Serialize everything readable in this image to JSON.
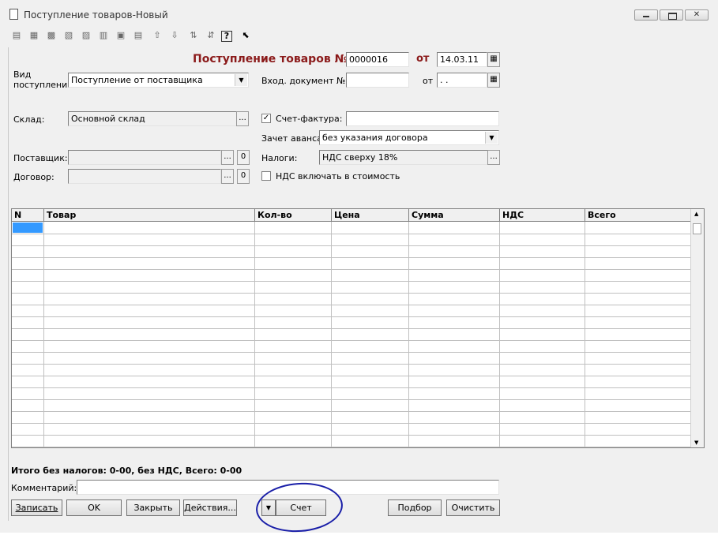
{
  "window": {
    "title": "Поступление товаров-Новый"
  },
  "header": {
    "doc_title": "Поступление товаров №",
    "doc_number": "0000016",
    "date_label": "от",
    "date_value": "14.03.11"
  },
  "form": {
    "receipt_type_label_line1": "Вид",
    "receipt_type_label_line2": "поступления:",
    "receipt_type_value": "Поступление от поставщика",
    "incoming_doc_label": "Вход. документ №",
    "incoming_doc_value": "",
    "incoming_date_label": "от",
    "incoming_date_value": " .  .",
    "warehouse_label": "Склад:",
    "warehouse_value": "Основной склад",
    "invoice_label": "Счет-фактура:",
    "invoice_checked": "✓",
    "invoice_value": "",
    "advance_label": "Зачет аванса:",
    "advance_value": "без указания договора",
    "supplier_label": "Поставщик:",
    "supplier_value": "",
    "taxes_label": "Налоги:",
    "taxes_value": "НДС сверху 18%",
    "contract_label": "Договор:",
    "contract_value": "",
    "vat_include_label": "НДС включать в стоимость",
    "ellipsis": "...",
    "zero_btn": "0"
  },
  "grid": {
    "columns": [
      "N",
      "Товар",
      "Кол-во",
      "Цена",
      "Сумма",
      "НДС",
      "Всего"
    ]
  },
  "footer": {
    "totals": "Итого без налогов: 0-00, без НДС, Всего: 0-00",
    "comment_label": "Комментарий:",
    "comment_value": "",
    "btn_save": "Записать",
    "btn_ok": "OK",
    "btn_close": "Закрыть",
    "btn_actions": "Действия...",
    "btn_invoice": "Счет",
    "btn_select": "Подбор",
    "btn_clear": "Очистить"
  },
  "colors": {
    "accent_title": "#8b1a1a",
    "annotation_circle": "#1a1fa8",
    "selected_cell": "#3399ff"
  }
}
